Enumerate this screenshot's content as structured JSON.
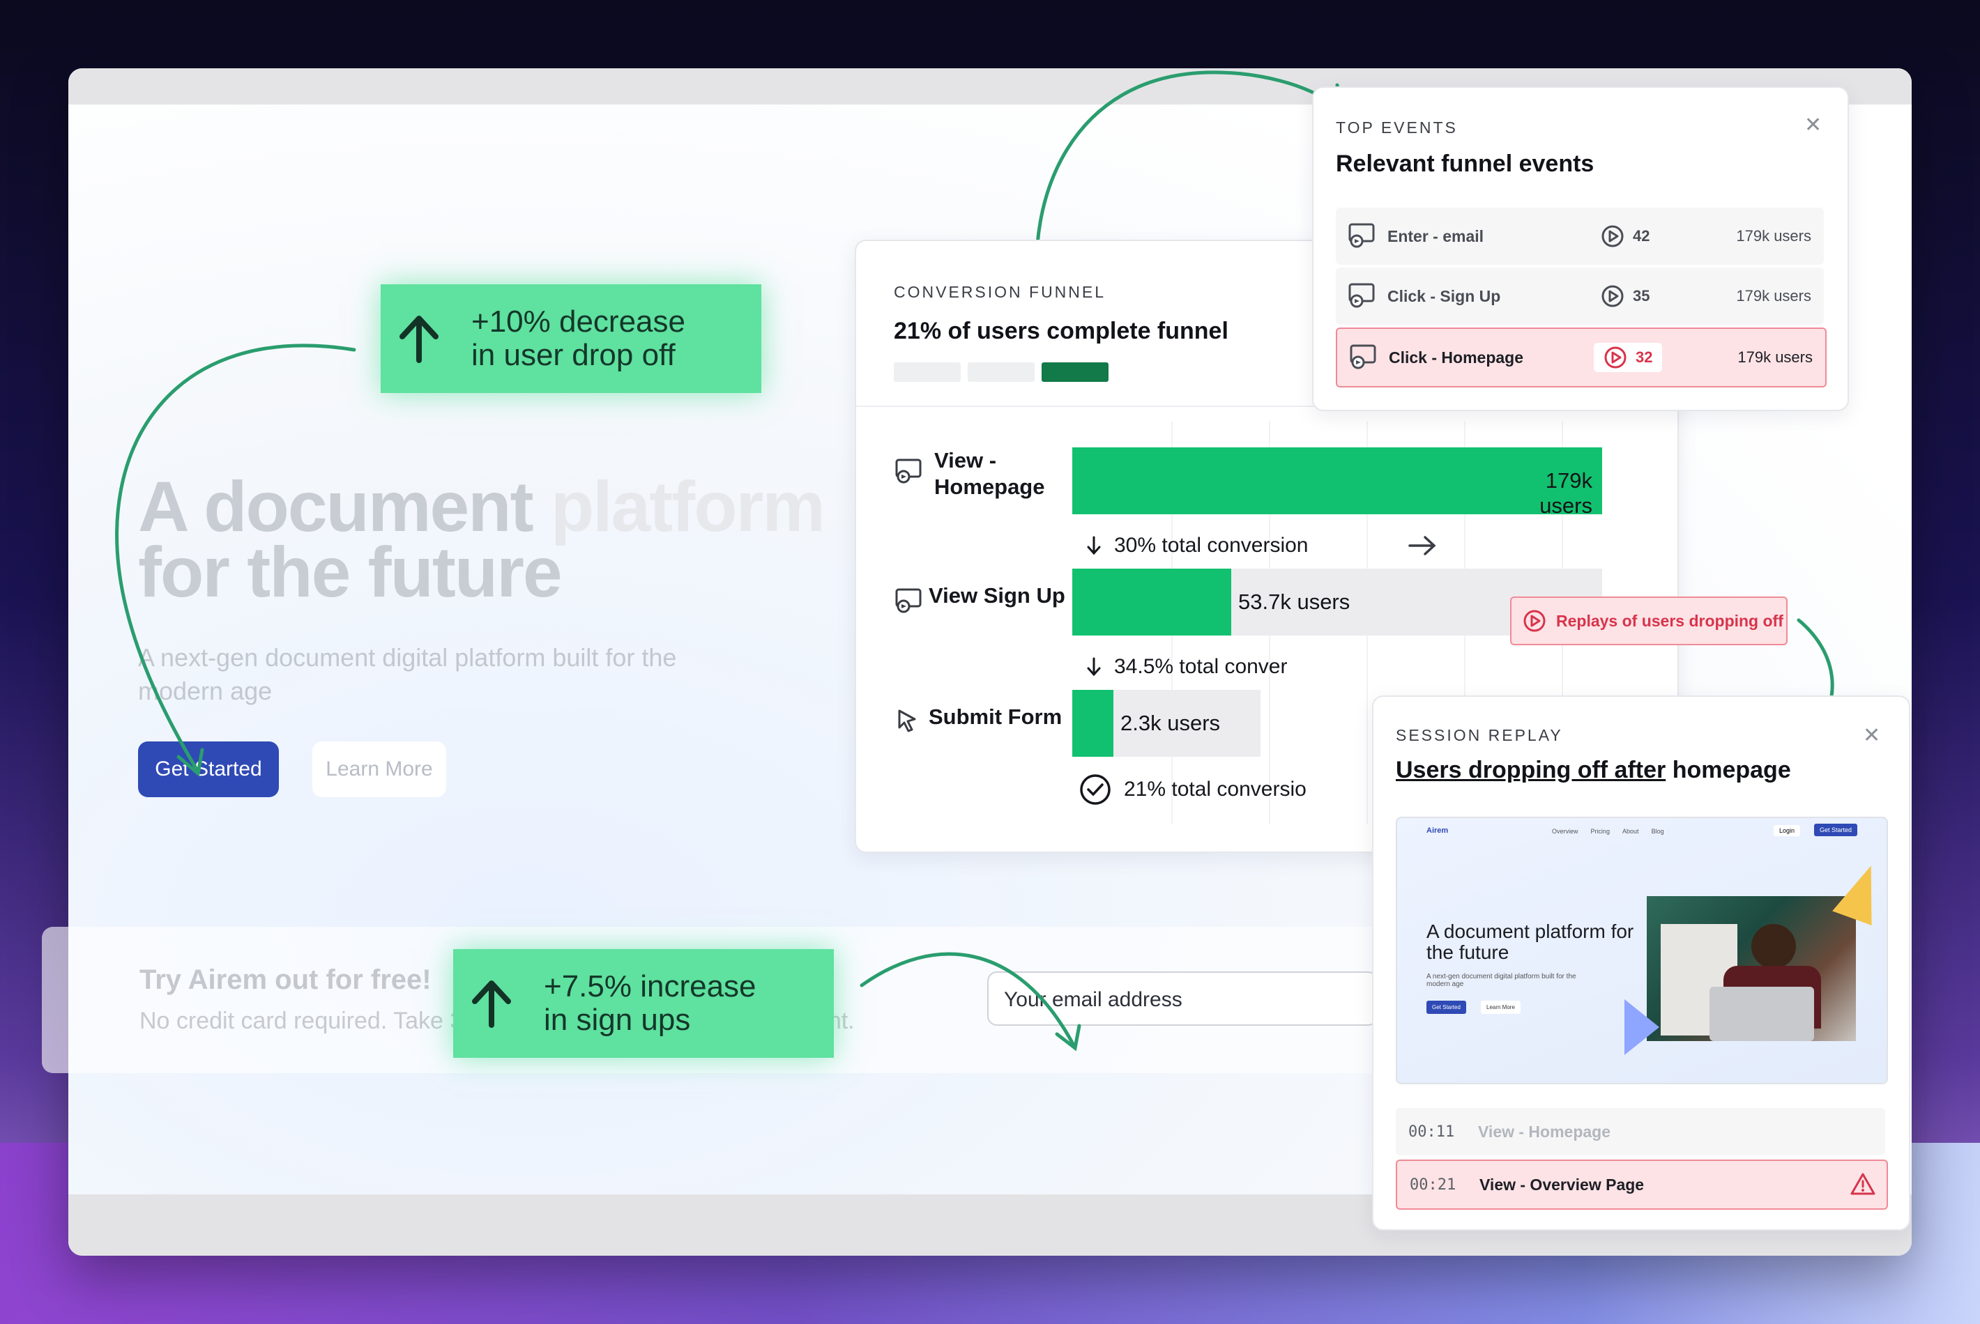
{
  "badges": {
    "drop_off": "+10% decrease\nin user drop off",
    "sign_ups": "+7.5% increase\nin sign ups"
  },
  "hero": {
    "title_part1": "A document",
    "title_part2": "platform",
    "title_line2": "for the future",
    "subtitle": "A next-gen document digital platform built for the modern age",
    "get_started": "Get Started",
    "learn_more": "Learn More"
  },
  "trial": {
    "title": "Try Airem out for free!",
    "subtitle": "No credit card required. Take 30 days to see the future of document.",
    "email_placeholder": "Your email address"
  },
  "funnel": {
    "caption": "CONVERSION FUNNEL",
    "headline": "21% of users complete funnel",
    "steps": [
      {
        "label_1": "View -",
        "label_2": "Homepage",
        "users": "179k users",
        "share": 1.0
      },
      {
        "label": "View Sign Up",
        "users": "53.7k users",
        "share": 0.3
      },
      {
        "label": "Submit Form",
        "users": "2.3k users",
        "share": 0.077
      }
    ],
    "conversions": [
      "30% total conversion",
      "34.5% total conver",
      "21% total conversio"
    ],
    "replay_button": "Replays of users dropping off"
  },
  "top_events": {
    "caption": "TOP EVENTS",
    "title": "Relevant funnel events",
    "rows": [
      {
        "label": "Enter - email",
        "count": "42",
        "users": "179k users"
      },
      {
        "label": "Click - Sign Up",
        "count": "35",
        "users": "179k users"
      },
      {
        "label": "Click - Homepage",
        "count": "32",
        "users": "179k users"
      }
    ]
  },
  "session_replay": {
    "caption": "SESSION REPLAY",
    "title_underlined": "Users dropping off after",
    "title_rest": " homepage",
    "preview": {
      "logo": "Airem",
      "nav": [
        "Overview",
        "Pricing",
        "About",
        "Blog"
      ],
      "login": "Login",
      "cta": "Get Started",
      "headline": "A document platform for the future",
      "sub": "A next-gen document digital platform built for the modern age",
      "btn1": "Get Started",
      "btn2": "Learn More"
    },
    "timeline": [
      {
        "time": "00:11",
        "label": "View - Homepage"
      },
      {
        "time": "00:21",
        "label": "View - Overview Page"
      }
    ]
  },
  "colors": {
    "accent_green": "#12c16f",
    "badge_green": "#5fe19f",
    "alert_red": "#d8344c",
    "primary_blue": "#2f4ab5"
  },
  "icons": [
    "arrow-up-icon",
    "replay-icon",
    "play-circle-icon",
    "close-icon",
    "cursor-icon",
    "check-circle-icon",
    "arrow-down-icon",
    "arrow-right-icon",
    "warning-icon"
  ]
}
